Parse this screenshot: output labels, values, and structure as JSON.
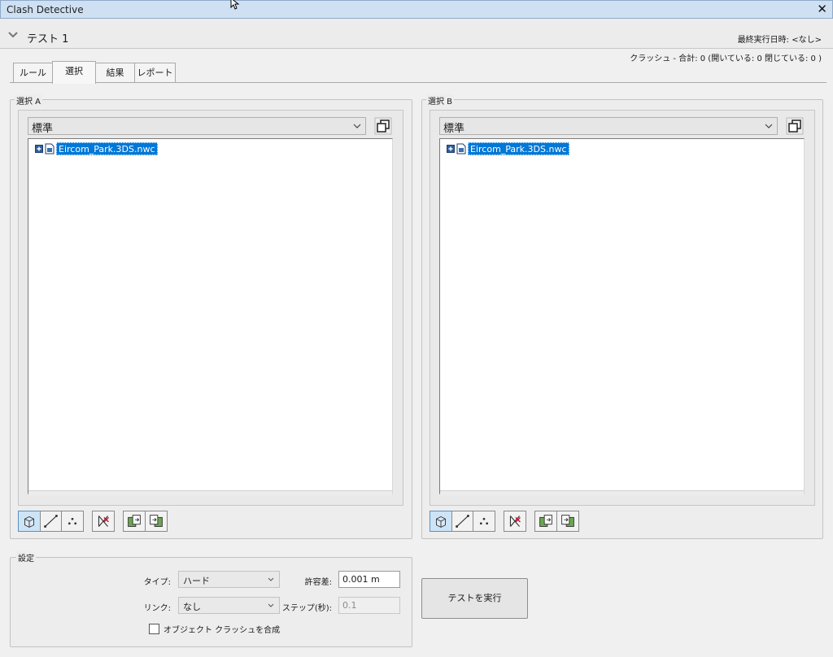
{
  "window": {
    "title": "Clash Detective",
    "close_glyph": "✕"
  },
  "test": {
    "name": "テスト 1",
    "last_run_label": "最終実行日時:  <なし>",
    "summary": "クラッシュ -  合計:  0  (開いている:  0  閉じている:  0 )"
  },
  "tabs": [
    {
      "label": "ルール"
    },
    {
      "label": "選択"
    },
    {
      "label": "結果"
    },
    {
      "label": "レポート"
    }
  ],
  "selection_a": {
    "legend": "選択 A",
    "mode": "標準",
    "tree_item": "Eircom_Park.3DS.nwc"
  },
  "selection_b": {
    "legend": "選択 B",
    "mode": "標準",
    "tree_item": "Eircom_Park.3DS.nwc"
  },
  "settings": {
    "legend": "設定",
    "type_label": "タイプ:",
    "type_value": "ハード",
    "tolerance_label": "許容差:",
    "tolerance_value": "0.001 m",
    "link_label": "リンク:",
    "link_value": "なし",
    "step_label": "ステップ(秒):",
    "step_value": "0.1",
    "composite_label": "オブジェクト クラッシュを合成"
  },
  "run_button": "テストを実行",
  "colors": {
    "accent": "#0078d7",
    "titlebar": "#cfe0f3",
    "toggle_on": "#cde4f7"
  }
}
